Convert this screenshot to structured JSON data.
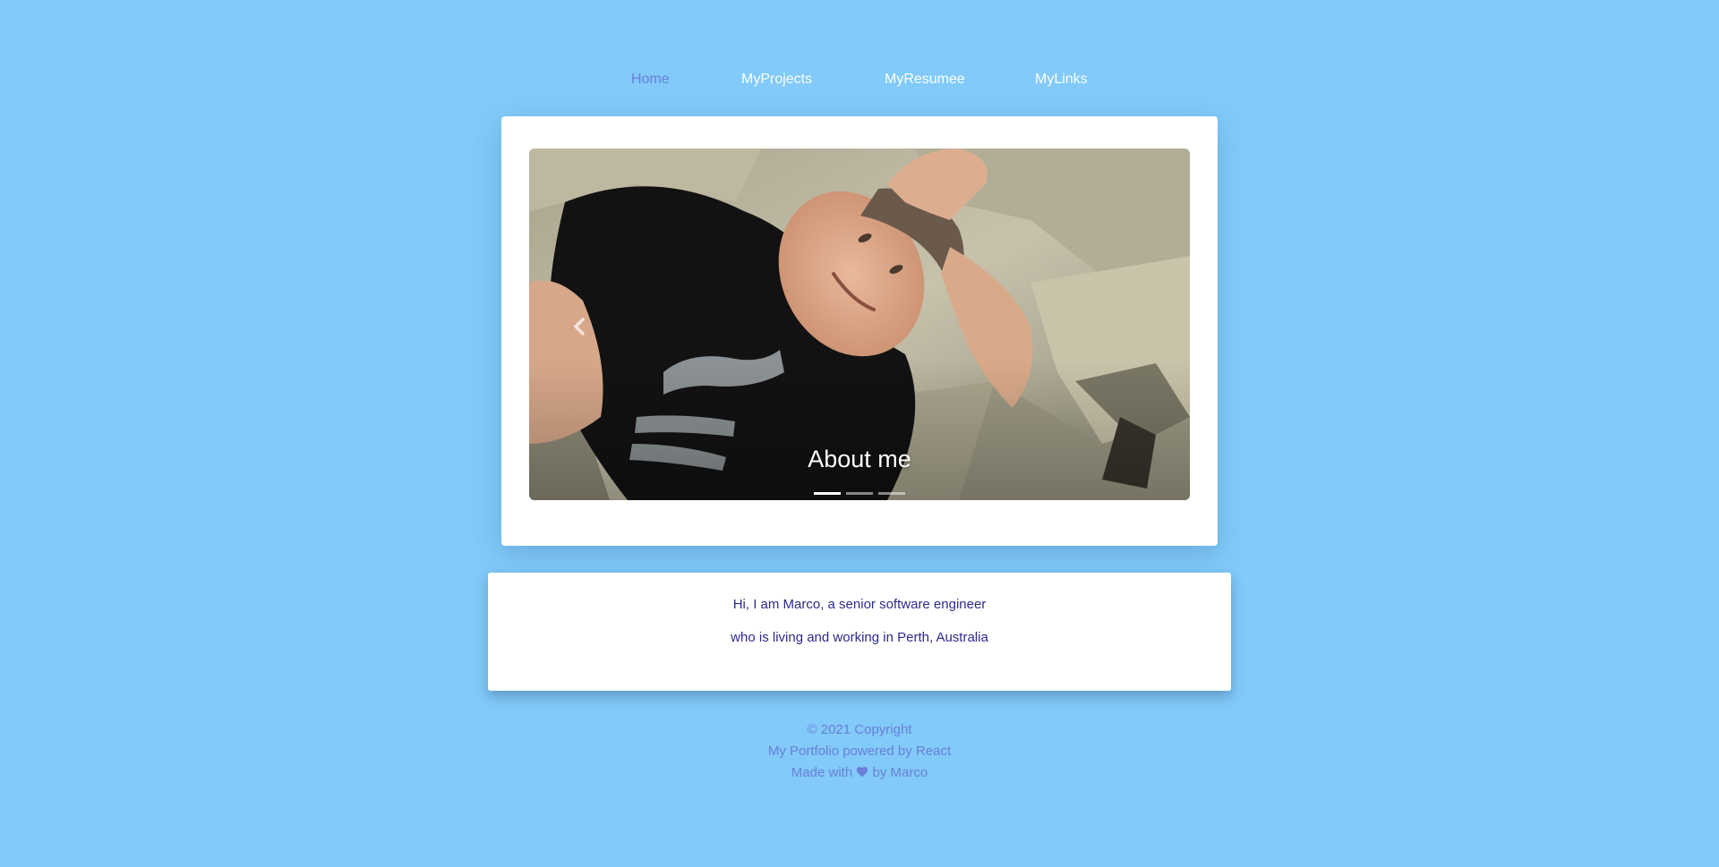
{
  "nav": {
    "items": [
      {
        "label": "Home",
        "active": true
      },
      {
        "label": "MyProjects",
        "active": false
      },
      {
        "label": "MyResumee",
        "active": false
      },
      {
        "label": "MyLinks",
        "active": false
      }
    ]
  },
  "carousel": {
    "caption": "About me",
    "slide_count": 3,
    "active_slide": 1,
    "prev_icon": "chevron-left-icon"
  },
  "about": {
    "line1": "Hi, I am Marco, a senior software engineer",
    "line2": "who is living and working in Perth, Australia"
  },
  "footer": {
    "copyright": "© 2021 Copyright",
    "powered": "My Portfolio powered by React",
    "made_prefix": "Made with",
    "made_suffix": "by Marco",
    "heart_icon": "heart-icon"
  },
  "colors": {
    "background": "#81caf9",
    "nav_active": "#6a7fd8",
    "text_dark": "#2c2a8c",
    "footer_text": "#6a7fd8"
  }
}
